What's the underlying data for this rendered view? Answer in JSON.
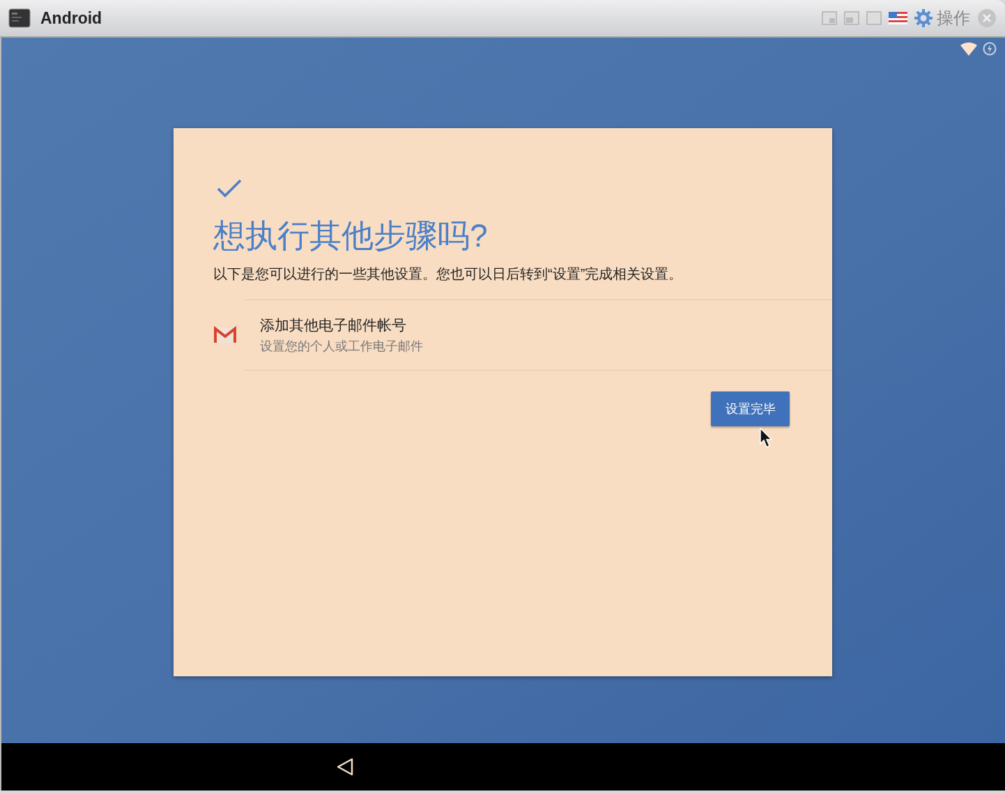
{
  "window": {
    "title": "Android",
    "menu_label": "操作"
  },
  "dialog": {
    "heading": "想执行其他步骤吗?",
    "description": "以下是您可以进行的一些其他设置。您也可以日后转到“设置”完成相关设置。",
    "options": [
      {
        "title": "添加其他电子邮件帐号",
        "subtitle": "设置您的个人或工作电子邮件"
      }
    ],
    "done_button": "设置完毕"
  }
}
